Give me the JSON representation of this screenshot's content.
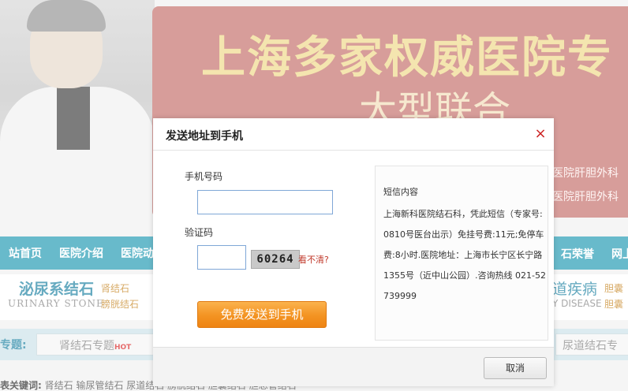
{
  "background": {
    "banner_title": "上海多家权威医院专",
    "banner_subtitle": "大型联合",
    "banner_side": [
      "医院肝胆外科",
      "医院肝胆外科"
    ],
    "nav_items": [
      "站首页",
      "医院介绍",
      "医院动态"
    ],
    "nav_right_items": [
      "石荣誉",
      "网上"
    ],
    "brand_name": "泌尿系结石",
    "brand_en": "URINARY STONE",
    "brand_links": [
      "肾结石",
      "膀胱结石"
    ],
    "brand_right": "道疾病",
    "brand_right_en": "Y DISEASE",
    "brand_right_links": [
      "胆囊",
      "胆囊"
    ],
    "topic_label": "专题:",
    "topic_box": "肾结石专题",
    "topic_hot": "HOT",
    "topic_box_right": "尿道结石专",
    "keywords_label": "表关键词:",
    "keywords": "肾结石    输尿管结石    尿道结石    膀胱结石    胆囊结石    胆总管结石"
  },
  "dialog": {
    "title": "发送地址到手机",
    "close_glyph": "×",
    "phone_label": "手机号码",
    "phone_value": "",
    "code_label": "验证码",
    "code_value": "",
    "captcha_text": "60264",
    "captcha_refresh": "看不清?",
    "send_button": "免费发送到手机",
    "sms_title": "短信内容",
    "sms_body": "上海新科医院结石科，凭此短信（专家号:0810号医台出示）免挂号费:11元;免停车费:8小时.医院地址：上海市长宁区长宁路1355号（近中山公园）.咨询热线 021-52739999",
    "cancel_button": "取消"
  }
}
